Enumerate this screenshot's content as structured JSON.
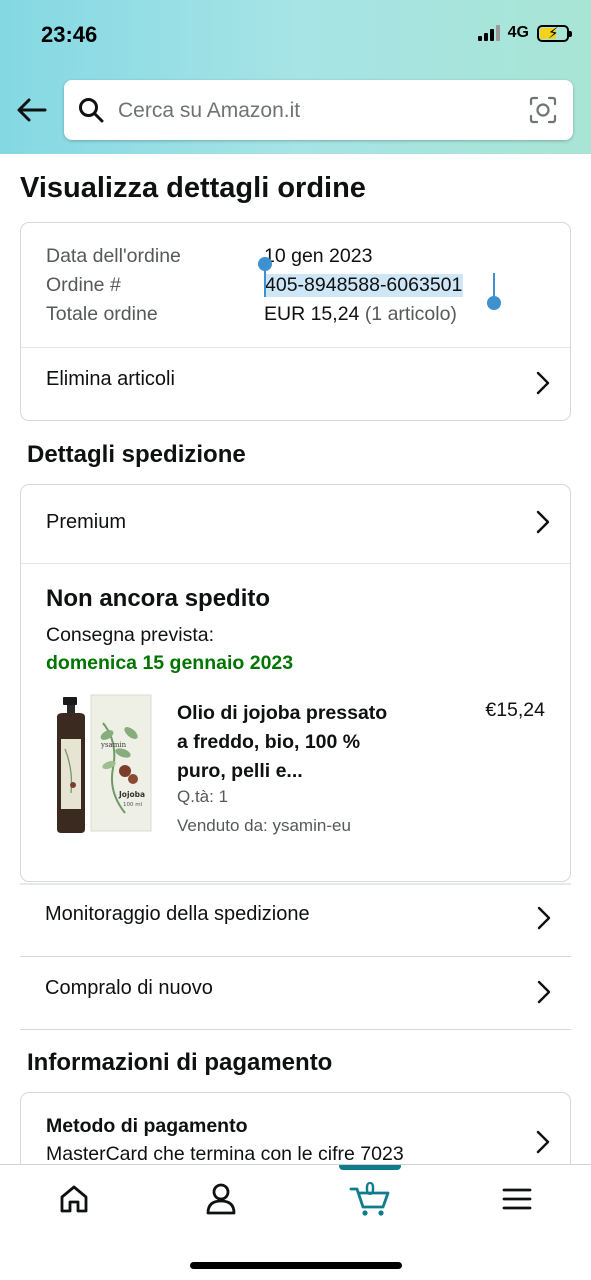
{
  "status_bar": {
    "time": "23:46",
    "network": "4G"
  },
  "search": {
    "placeholder": "Cerca su Amazon.it"
  },
  "page_title": "Visualizza dettagli ordine",
  "order_summary": {
    "date_label": "Data dell'ordine",
    "date_value": "10 gen 2023",
    "order_label": "Ordine #",
    "order_value": "405-8948588-6063501",
    "total_label": "Totale ordine",
    "total_value": "EUR 15,24",
    "total_items": "(1 articolo)",
    "delete_items_label": "Elimina articoli"
  },
  "shipping": {
    "section_title": "Dettagli spedizione",
    "shipping_method": "Premium",
    "status_title": "Non ancora spedito",
    "delivery_label": "Consegna prevista:",
    "delivery_date": "domenica 15 gennaio 2023",
    "delivery_date_color": "#007600",
    "product": {
      "title_line1": "Olio di jojoba pressato",
      "title_line2": "a freddo, bio, 100 %",
      "title_line3": "puro, pelli e...",
      "price": "€15,24",
      "quantity": "Q.tà: 1",
      "seller": "Venduto da: ysamin-eu",
      "image_brand": "ysamin",
      "image_product_name": "Jojoba",
      "image_volume": "100 ml"
    },
    "tracking_label": "Monitoraggio della spedizione",
    "buy_again_label": "Compralo di nuovo"
  },
  "payment": {
    "section_title": "Informazioni di pagamento",
    "method_title": "Metodo di pagamento",
    "method_value": "MasterCard che termina con le cifre 7023"
  },
  "bottom_nav": {
    "items": [
      "home-icon",
      "account-icon",
      "cart-icon",
      "menu-icon"
    ],
    "cart_count": "0",
    "accent_color": "#0f7c8e"
  }
}
